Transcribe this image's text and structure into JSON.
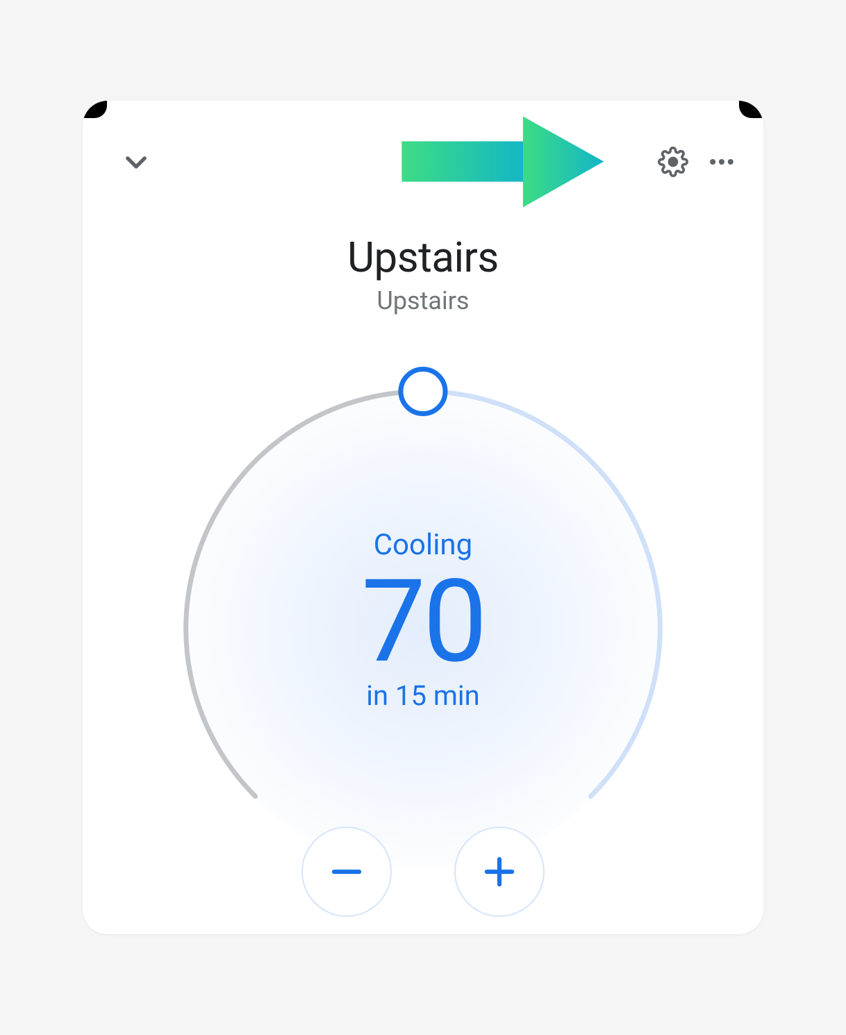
{
  "header": {
    "chevron_icon_name": "chevron-down-icon",
    "gear_icon_name": "gear-icon",
    "more_icon_name": "more-horizontal-icon"
  },
  "overlay": {
    "arrow_icon_name": "pointer-arrow-icon"
  },
  "device": {
    "name": "Upstairs",
    "room": "Upstairs"
  },
  "thermostat": {
    "mode": "Cooling",
    "target_temp": "70",
    "eta": "in 15 min",
    "minus_icon_name": "minus-icon",
    "plus_icon_name": "plus-icon"
  },
  "colors": {
    "accent": "#1a73e8",
    "gray_arc": "#c3c6c9",
    "blue_arc": "#cfe0f8",
    "fill_grad_inner": "#e8f0fd",
    "fill_grad_outer": "#ffffff"
  }
}
